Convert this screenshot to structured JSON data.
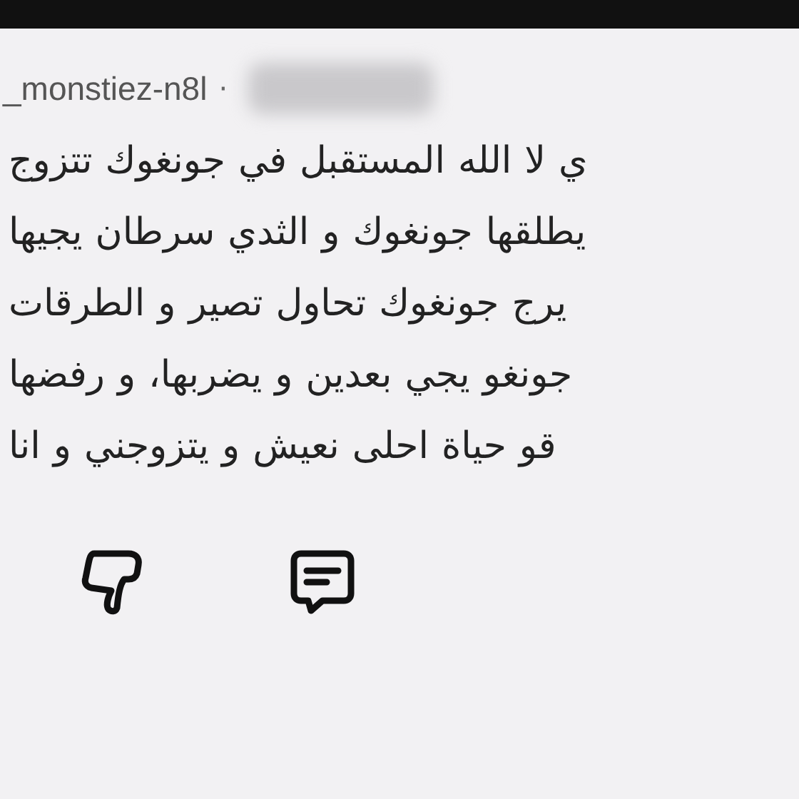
{
  "comment": {
    "author": "_monstiez-n8l",
    "separator": "·",
    "lines": [
      "تتزوج جونغوك في المستقبل الله لا ي",
      "يجيها سرطان الثدي و جونغوك يطلقها",
      "الطرقات و تصير تحاول جونغوك يرج",
      "رفضها و يضربها، و بعدين يجي جونغو",
      "انا و يتزوجني و نعيش احلى حياة قو"
    ]
  }
}
